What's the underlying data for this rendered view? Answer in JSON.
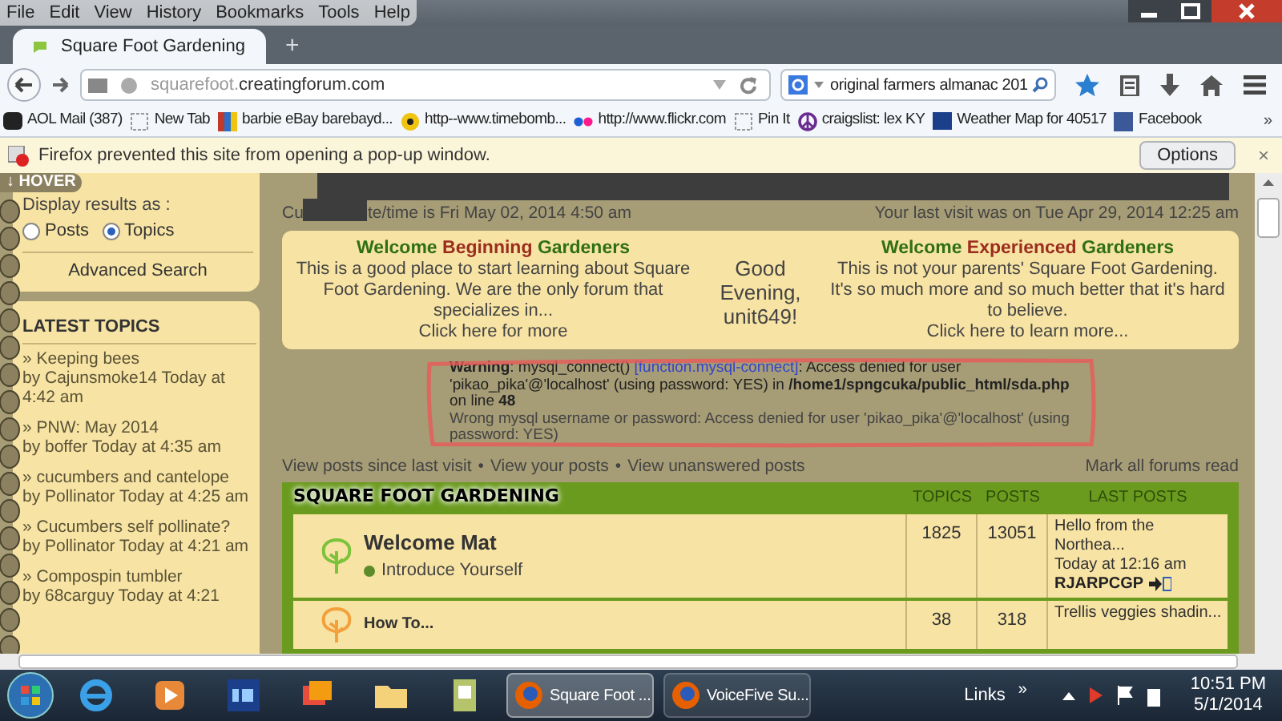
{
  "menu_bar": {
    "items": [
      "File",
      "Edit",
      "View",
      "History",
      "Bookmarks",
      "Tools",
      "Help"
    ]
  },
  "tabs": [
    {
      "label": "Square Foot Gardening",
      "selected": true
    }
  ],
  "new_tab": "+",
  "nav": {
    "url": {
      "subdomain": "squarefoot.",
      "domain": "creatingforum.com"
    },
    "search_value": "original farmers almanac 201"
  },
  "bookmarks": [
    {
      "label": "AOL Mail (387)"
    },
    {
      "label": "New Tab"
    },
    {
      "label": "barbie eBay barebayd..."
    },
    {
      "label": "http--www.timebomb..."
    },
    {
      "label": "http://www.flickr.com"
    },
    {
      "label": "Pin It"
    },
    {
      "label": "craigslist: lex KY"
    },
    {
      "label": "Weather Map for 40517"
    },
    {
      "label": "Facebook"
    }
  ],
  "bookmarks_more": "»",
  "notification": {
    "message": "Firefox prevented this site from opening a pop-up window.",
    "button": "Options",
    "close": "×"
  },
  "sidebar": {
    "hover_tab": "↓ HOVER",
    "display_label": "Display results as :",
    "options": [
      {
        "label": "Posts",
        "selected": false
      },
      {
        "label": "Topics",
        "selected": true
      }
    ],
    "advanced_search": "Advanced Search",
    "latest_title": "LATEST TOPICS",
    "topics": [
      {
        "title": "» Keeping bees",
        "byline": "by Cajunsmoke14 Today at 4:42 am"
      },
      {
        "title": "» PNW: May 2014",
        "byline": "by boffer Today at 4:35 am"
      },
      {
        "title": "» cucumbers and cantelope",
        "byline": "by Pollinator Today at 4:25 am"
      },
      {
        "title": "» Cucumbers self pollinate?",
        "byline": "by Pollinator Today at 4:21 am"
      },
      {
        "title": "» Compospin tumbler",
        "byline": "by 68carguy Today at 4:21"
      }
    ]
  },
  "page": {
    "date_prefix": "Cu",
    "date_rest": "te/time is Fri May 02, 2014 4:50 am",
    "last_visit": "Your last visit was on Tue Apr 29, 2014 12:25 am",
    "welcome": [
      {
        "heading": [
          "Welcome",
          "Beginning",
          "Gardeners"
        ],
        "text": "This is a good place to start learning about Square Foot Gardening. We are the only forum that specializes in...",
        "link": "Click here for more"
      },
      {
        "heading": [
          "Welcome",
          "Experienced",
          "Gardeners"
        ],
        "text": "This is not your parents' Square Foot Gardening. It's so much more and so much better that it's hard to believe.",
        "link": "Click here to learn more..."
      }
    ],
    "greeting": "Good Evening, unit649!",
    "warning": {
      "lead": "**Warning**: mysql_connect()",
      "link": "[function.mysql-connect]",
      "rest": ": Access denied for user 'pikao_pika'@'localhost' (using password: YES) in **/home1/spngcuka/public_html/sda.php** on line **48**",
      "error": "Wrong mysql username or password: Access denied for user 'pikao_pika'@'localhost' (using password: YES)"
    },
    "links": [
      "View posts since last visit",
      "View your posts",
      "View unanswered posts"
    ],
    "separator": "•",
    "mark_read": "Mark all forums read",
    "forum": {
      "title": "SQUARE FOOT GARDENING",
      "columns": [
        "TOPICS",
        "POSTS",
        "LAST POSTS"
      ],
      "rows": [
        {
          "name": "Welcome Mat",
          "subforum": "Introduce Yourself",
          "topics": "1825",
          "posts": "13051",
          "last_post": "Hello from the Northea...",
          "last_time": "Today at 12:16 am",
          "last_user": "RJARPCGP",
          "color": "#7cc23a"
        },
        {
          "name": "How To...",
          "topics": "38",
          "posts": "318",
          "last_post": "Trellis veggies shadin...",
          "color": "#f2a13c"
        }
      ]
    }
  },
  "taskbar": {
    "tasks": [
      {
        "label": "Square Foot ...",
        "selected": true
      },
      {
        "label": "VoiceFive Su...",
        "selected": false
      }
    ],
    "links": "Links",
    "more": "»",
    "time": "10:51 PM",
    "date": "5/1/2014"
  }
}
